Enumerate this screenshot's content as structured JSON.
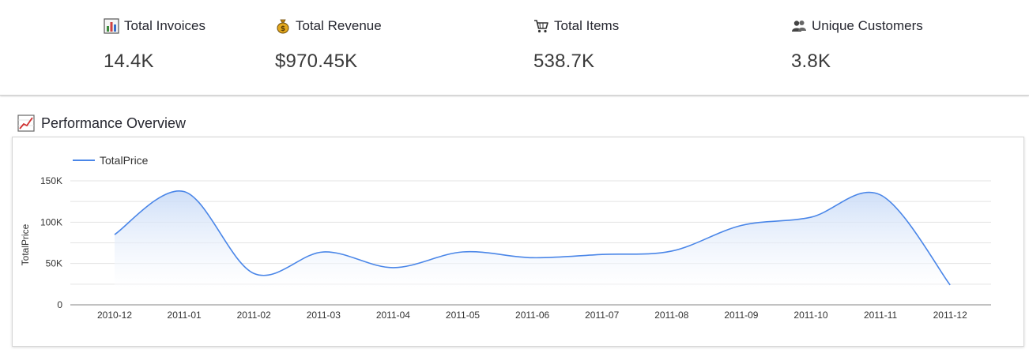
{
  "kpis": [
    {
      "label": "Total Invoices",
      "value": "14.4K",
      "icon": "bar-chart-icon"
    },
    {
      "label": "Total Revenue",
      "value": "$970.45K",
      "icon": "money-bag-icon"
    },
    {
      "label": "Total Items",
      "value": "538.7K",
      "icon": "shopping-cart-icon"
    },
    {
      "label": "Unique Customers",
      "value": "3.8K",
      "icon": "users-icon"
    }
  ],
  "section": {
    "title": "Performance Overview",
    "icon": "trend-chart-icon"
  },
  "colors": {
    "line": "#4a86e8",
    "fill_top": "#c9dbf7",
    "fill_bottom": "#ffffff",
    "grid": "#e3e3e3",
    "axis": "#9e9e9e"
  },
  "chart_data": {
    "type": "area",
    "x": [
      "2010-12",
      "2011-01",
      "2011-02",
      "2011-03",
      "2011-04",
      "2011-05",
      "2011-06",
      "2011-07",
      "2011-08",
      "2011-09",
      "2011-10",
      "2011-11",
      "2011-12"
    ],
    "series": [
      {
        "name": "TotalPrice",
        "values": [
          85000,
          137000,
          38000,
          64000,
          45000,
          64000,
          57000,
          61000,
          65000,
          96000,
          106000,
          133000,
          24000
        ]
      }
    ],
    "ylabel": "TotalPrice",
    "xlabel": "",
    "ylim": [
      0,
      150000
    ],
    "y_ticks": [
      0,
      50000,
      100000,
      150000
    ],
    "y_tick_labels": [
      "0",
      "50K",
      "100K",
      "150K"
    ],
    "legend": "top-left",
    "grid": true
  }
}
